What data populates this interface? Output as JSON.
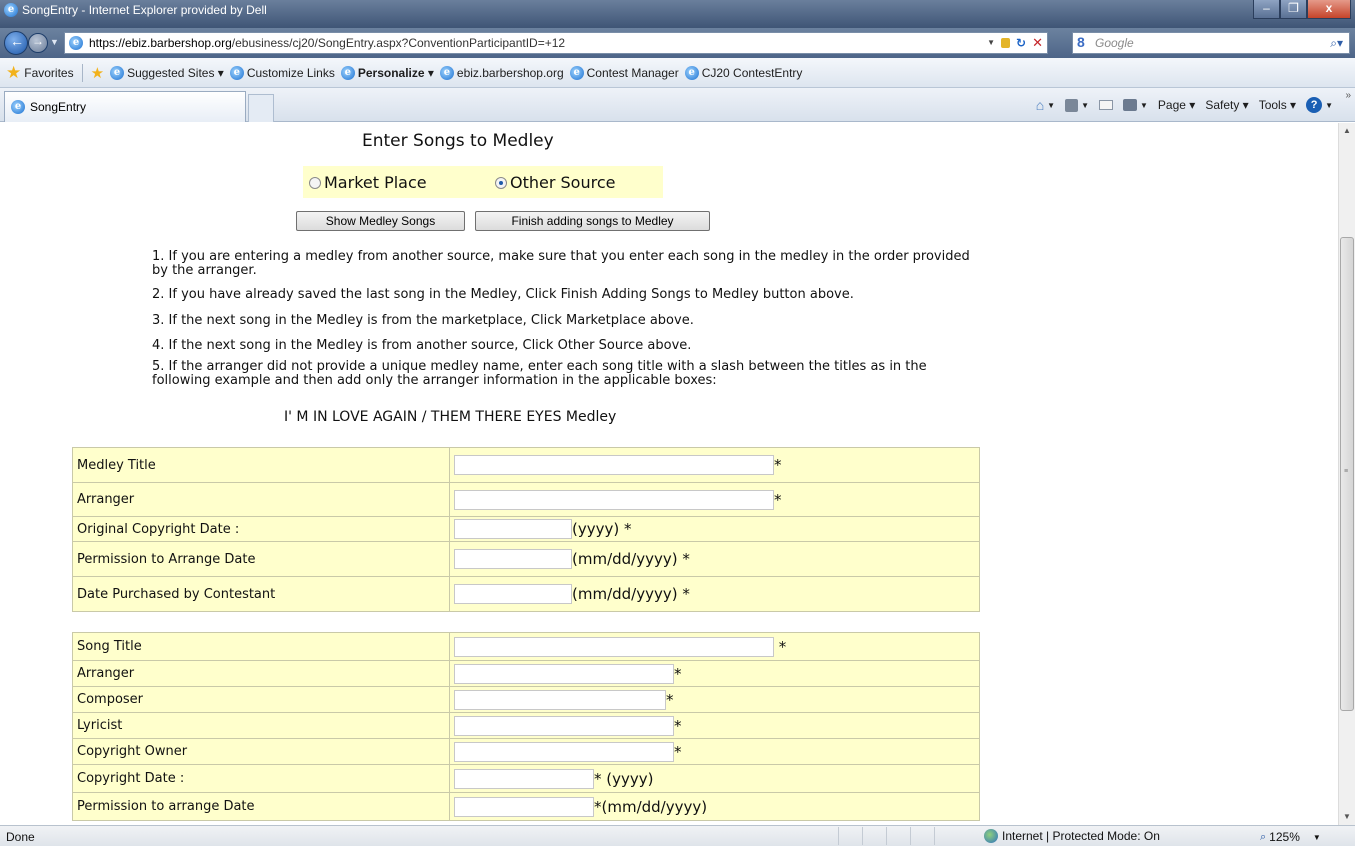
{
  "window": {
    "title": "SongEntry - Internet Explorer provided by Dell",
    "minimize": "–",
    "maximize": "❐",
    "close": "x"
  },
  "address_bar": {
    "url_host": "https://ebiz.barbershop.org",
    "url_path": "/ebusiness/cj20/SongEntry.aspx?ConventionParticipantID=+12",
    "search_placeholder": "Google"
  },
  "favorites_bar": {
    "favorites_label": "Favorites",
    "items": [
      "Suggested Sites ▾",
      "Customize Links",
      "Personalize ▾",
      "ebiz.barbershop.org",
      "Contest Manager",
      "CJ20 ContestEntry"
    ]
  },
  "tab": {
    "label": "SongEntry"
  },
  "command_bar": {
    "page": "Page ▾",
    "safety": "Safety ▾",
    "tools": "Tools ▾"
  },
  "page": {
    "heading": "Enter Songs to Medley",
    "radio_marketplace": "Market Place",
    "radio_other": "Other Source",
    "selected_source": "Other Source",
    "btn_show": "Show Medley Songs",
    "btn_finish": "Finish adding songs to Medley",
    "instructions": [
      "1. If you are entering a medley from another source, make sure that you enter each song in the medley in the order provided by the arranger.",
      "2. If you have already saved the last song in the Medley, Click Finish Adding Songs to Medley button above.",
      "3. If the next song in the Medley is from the marketplace, Click Marketplace above.",
      "4. If the next song in the Medley is from another source, Click Other Source above.",
      "5. If the arranger did not provide a unique medley name, enter each song title with a slash between the titles as in the following example and then add only the arranger information in the applicable boxes:"
    ],
    "example": "I' M IN LOVE AGAIN / THEM THERE EYES Medley",
    "medley_form": [
      {
        "label": "Medley Title",
        "value": "",
        "suffix": "*"
      },
      {
        "label": "Arranger",
        "value": "",
        "suffix": "*"
      },
      {
        "label": "Original Copyright Date :",
        "value": "",
        "suffix": "(yyyy) *"
      },
      {
        "label": "Permission to Arrange Date",
        "value": "",
        "suffix": "(mm/dd/yyyy) *"
      },
      {
        "label": "Date Purchased by Contestant",
        "value": "",
        "suffix": "(mm/dd/yyyy) *"
      }
    ],
    "song_form": [
      {
        "label": "Song Title",
        "value": "",
        "suffix": " *"
      },
      {
        "label": "Arranger",
        "value": "",
        "suffix": "*"
      },
      {
        "label": "Composer",
        "value": "",
        "suffix": "*"
      },
      {
        "label": "Lyricist",
        "value": "",
        "suffix": "*"
      },
      {
        "label": "Copyright Owner",
        "value": "",
        "suffix": "*"
      },
      {
        "label": "Copyright Date :",
        "value": "",
        "suffix": "* (yyyy)"
      },
      {
        "label": "Permission to arrange Date",
        "value": "",
        "suffix": "*(mm/dd/yyyy)"
      }
    ]
  },
  "status_bar": {
    "left": "Done",
    "zone": "Internet | Protected Mode: On",
    "zoom": "125%"
  }
}
